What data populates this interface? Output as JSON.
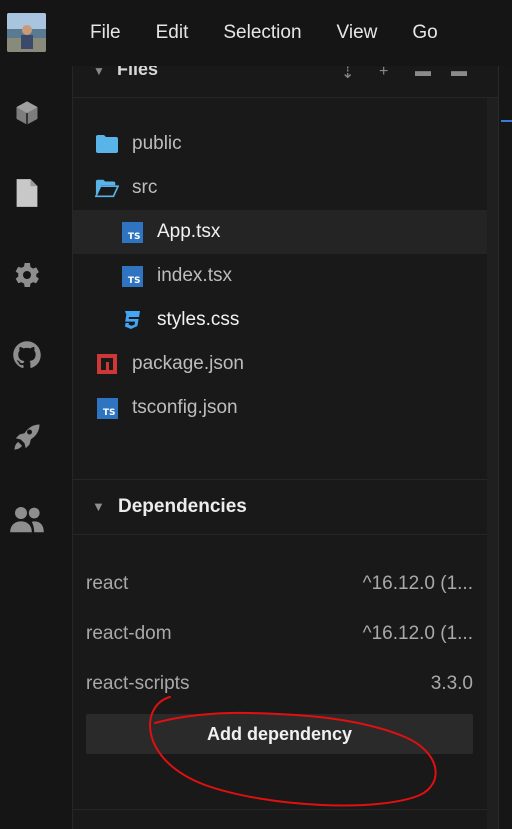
{
  "menubar": {
    "items": [
      "File",
      "Edit",
      "Selection",
      "View",
      "Go"
    ]
  },
  "activity_bar": {
    "icons": [
      "cube-icon",
      "file-icon",
      "gear-icon",
      "github-icon",
      "rocket-icon",
      "users-icon"
    ]
  },
  "files_panel": {
    "title": "Files",
    "items": [
      {
        "label": "public",
        "icon": "folder-icon"
      },
      {
        "label": "src",
        "icon": "folder-open-icon"
      },
      {
        "label": "App.tsx",
        "icon": "typescript-icon",
        "selected": true
      },
      {
        "label": "index.tsx",
        "icon": "typescript-icon"
      },
      {
        "label": "styles.css",
        "icon": "css-icon"
      },
      {
        "label": "package.json",
        "icon": "npm-icon"
      },
      {
        "label": "tsconfig.json",
        "icon": "typescript-icon"
      }
    ]
  },
  "dependencies": {
    "title": "Dependencies",
    "items": [
      {
        "name": "react",
        "version": "^16.12.0 (1..."
      },
      {
        "name": "react-dom",
        "version": "^16.12.0 (1..."
      },
      {
        "name": "react-scripts",
        "version": "3.3.0"
      }
    ],
    "add_label": "Add dependency"
  },
  "colors": {
    "background": "#151515",
    "panel": "#191919",
    "typescript": "#2f74c0",
    "folder": "#59b4e8",
    "css": "#42a5f5",
    "npm": "#cb3837",
    "annotation": "#e01010"
  }
}
